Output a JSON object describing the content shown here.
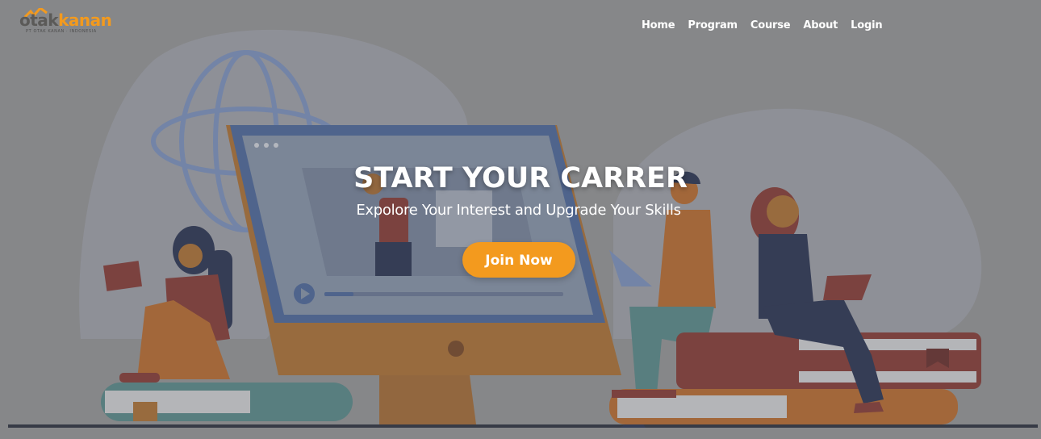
{
  "brand": {
    "name_part1": "otak",
    "name_part2": "kanan",
    "tagline": "PT OTAK KANAN · INDONESIA"
  },
  "nav": {
    "items": [
      "Home",
      "Program",
      "Course",
      "About",
      "Login"
    ]
  },
  "hero": {
    "title": "START YOUR CARRER",
    "subtitle": "Expolore Your Interest and Upgrade Your Skills",
    "cta_label": "Join Now"
  },
  "colors": {
    "accent": "#f39a1e",
    "overlay": "#8a8b8c",
    "text": "#ffffff"
  }
}
